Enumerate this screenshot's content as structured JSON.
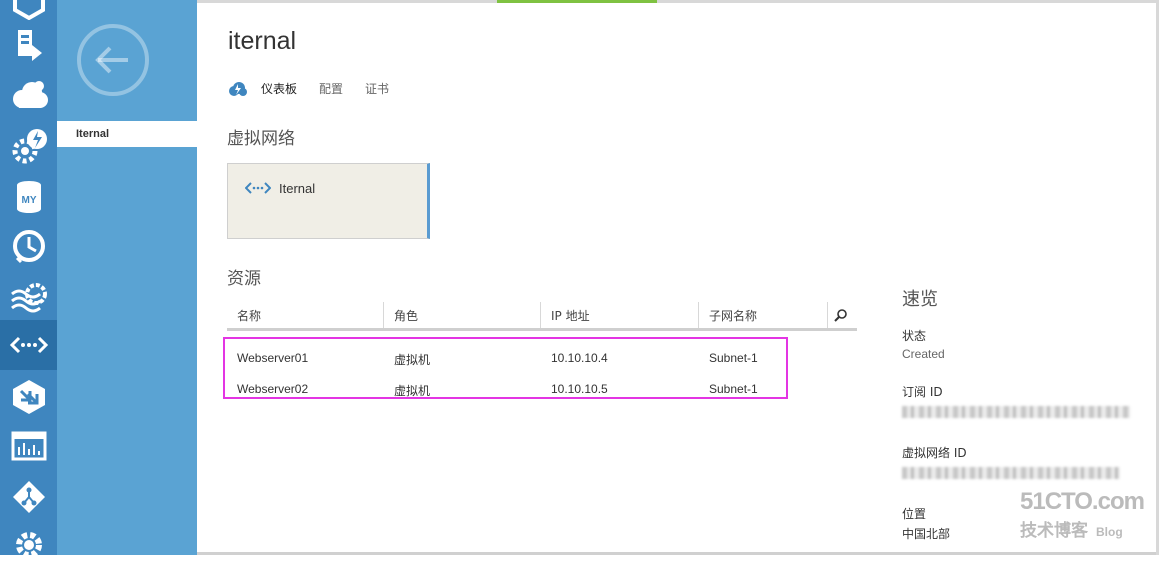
{
  "colors": {
    "nav_bg": "#3f86bf",
    "subnav_bg": "#5aa3d3",
    "highlight": "#e335e3",
    "accent": "#7fc241"
  },
  "nav": {
    "icons": [
      "cloud-service-icon",
      "web-deploy-icon",
      "cloud-icon",
      "gear-lightning-icon",
      "mysql-icon",
      "clock-icon",
      "hdinsight-icon",
      "virtual-network-icon",
      "traffic-manager-icon",
      "dashboard-icon",
      "git-icon",
      "settings-icon"
    ]
  },
  "subnav": {
    "selected_item": "Iternal"
  },
  "page": {
    "title": "iternal",
    "tabs": [
      "仪表板",
      "配置",
      "证书"
    ],
    "active_tab": 0
  },
  "vnet_section": {
    "heading": "虚拟网络",
    "tile_label": "Iternal"
  },
  "resources": {
    "heading": "资源",
    "columns": [
      "名称",
      "角色",
      "IP 地址",
      "子网名称"
    ],
    "rows": [
      {
        "name": "Webserver01",
        "role": "虚拟机",
        "ip": "10.10.10.4",
        "subnet": "Subnet-1"
      },
      {
        "name": "Webserver02",
        "role": "虚拟机",
        "ip": "10.10.10.5",
        "subnet": "Subnet-1"
      }
    ]
  },
  "summary": {
    "title": "速览",
    "status_label": "状态",
    "status_value": "Created",
    "subscription_label": "订阅 ID",
    "vnet_id_label": "虚拟网络 ID",
    "location_label": "位置",
    "location_value": "中国北部"
  },
  "watermark": {
    "site": "51CTO.com",
    "subtitle": "技术博客",
    "blog": "Blog"
  }
}
